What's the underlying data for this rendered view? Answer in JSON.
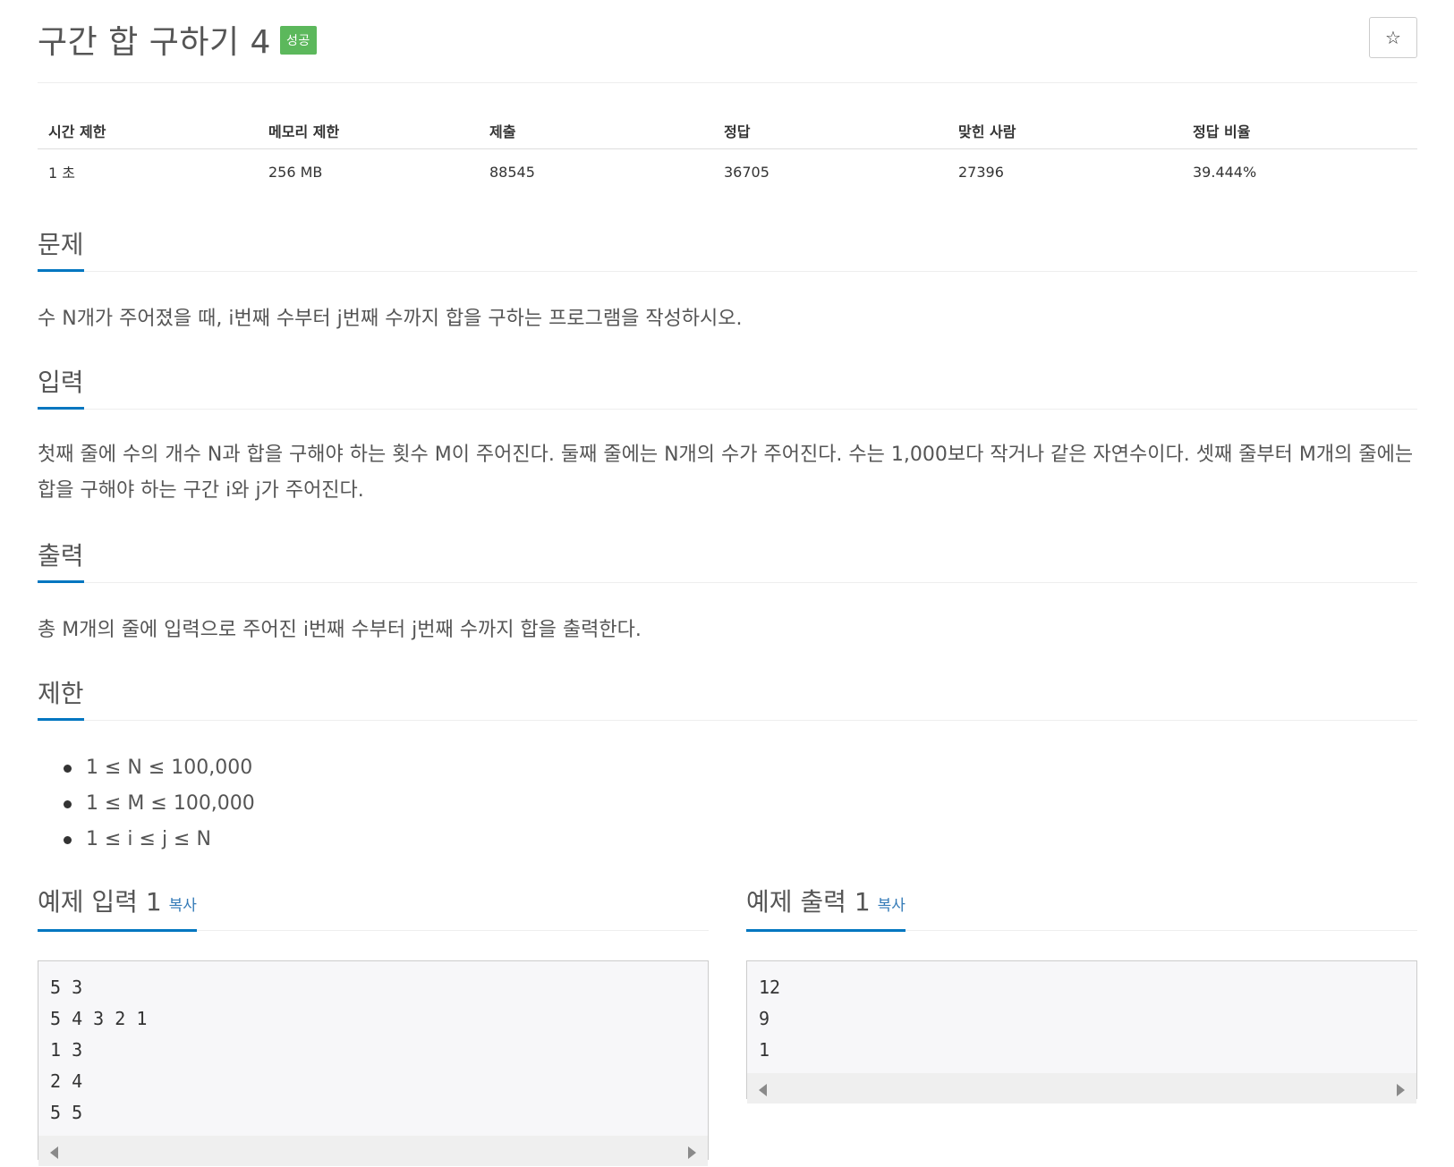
{
  "problem": {
    "title": "구간 합 구하기 4",
    "status_badge": "성공",
    "star_icon": "☆"
  },
  "info_table": {
    "headers": [
      "시간 제한",
      "메모리 제한",
      "제출",
      "정답",
      "맞힌 사람",
      "정답 비율"
    ],
    "values": [
      "1 초",
      "256 MB",
      "88545",
      "36705",
      "27396",
      "39.444%"
    ]
  },
  "sections": {
    "description": {
      "title": "문제",
      "text": "수 N개가 주어졌을 때, i번째 수부터 j번째 수까지 합을 구하는 프로그램을 작성하시오."
    },
    "input": {
      "title": "입력",
      "text": "첫째 줄에 수의 개수 N과 합을 구해야 하는 횟수 M이 주어진다. 둘째 줄에는 N개의 수가 주어진다. 수는 1,000보다 작거나 같은 자연수이다. 셋째 줄부터 M개의 줄에는 합을 구해야 하는 구간 i와 j가 주어진다."
    },
    "output": {
      "title": "출력",
      "text": "총 M개의 줄에 입력으로 주어진 i번째 수부터 j번째 수까지 합을 출력한다."
    },
    "limits": {
      "title": "제한",
      "items": [
        "1 ≤ N ≤ 100,000",
        "1 ≤ M ≤ 100,000",
        "1 ≤ i ≤ j ≤ N"
      ]
    }
  },
  "examples": {
    "input": {
      "title": "예제 입력 1",
      "copy_label": "복사",
      "content": "5 3\n5 4 3 2 1\n1 3\n2 4\n5 5"
    },
    "output": {
      "title": "예제 출력 1",
      "copy_label": "복사",
      "content": "12\n9\n1"
    }
  },
  "colors": {
    "badge_success": "#5cb85c",
    "section_underline": "#0076c0",
    "copy_link": "#337ab7"
  }
}
